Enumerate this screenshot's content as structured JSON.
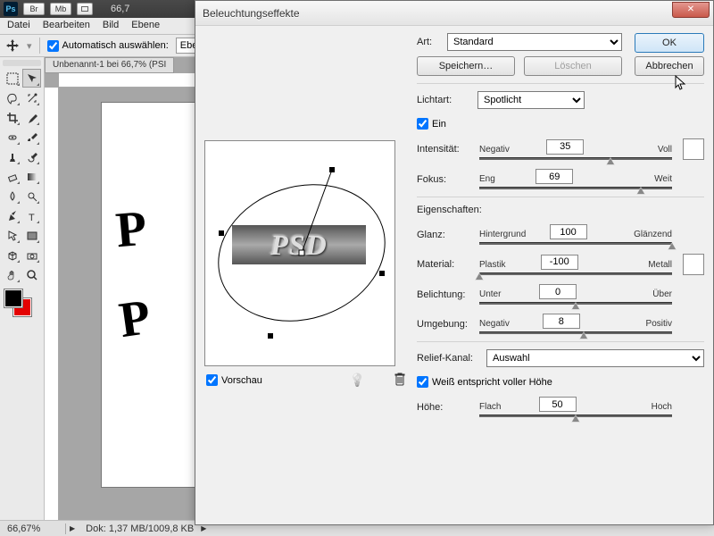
{
  "app": {
    "zoom_label": "66,7"
  },
  "titlebar_buttons": [
    "Br",
    "Mb"
  ],
  "menu": [
    "Datei",
    "Bearbeiten",
    "Bild",
    "Ebene"
  ],
  "options_bar": {
    "autoselect_label": "Automatisch auswählen:",
    "dropdown": "Ebe"
  },
  "document_tab": "Unbenannt-1 bei 66,7% (PSI",
  "canvas_text": "PSD",
  "statusbar": {
    "zoom": "66,67%",
    "docinfo": "Dok: 1,37 MB/1009,8 KB"
  },
  "dialog": {
    "title": "Beleuchtungseffekte",
    "buttons": {
      "ok": "OK",
      "cancel": "Abbrechen",
      "save": "Speichern…",
      "delete": "Löschen"
    },
    "art_label": "Art:",
    "art_value": "Standard",
    "preview_label": "Vorschau",
    "preview_text": "PSD",
    "lichtart_label": "Lichtart:",
    "lichtart_value": "Spotlicht",
    "ein_label": "Ein",
    "sliders": {
      "intensitaet": {
        "label": "Intensität:",
        "min": "Negativ",
        "max": "Voll",
        "value": 35,
        "pct": 68
      },
      "fokus": {
        "label": "Fokus:",
        "min": "Eng",
        "max": "Weit",
        "value": 69,
        "pct": 84
      },
      "glanz": {
        "label": "Glanz:",
        "min": "Hintergrund",
        "max": "Glänzend",
        "value": 100,
        "pct": 100
      },
      "material": {
        "label": "Material:",
        "min": "Plastik",
        "max": "Metall",
        "value": -100,
        "pct": 0
      },
      "belichtung": {
        "label": "Belichtung:",
        "min": "Unter",
        "max": "Über",
        "value": 0,
        "pct": 50
      },
      "umgebung": {
        "label": "Umgebung:",
        "min": "Negativ",
        "max": "Positiv",
        "value": 8,
        "pct": 54
      },
      "hoehe": {
        "label": "Höhe:",
        "min": "Flach",
        "max": "Hoch",
        "value": 50,
        "pct": 50
      }
    },
    "eigenschaften_label": "Eigenschaften:",
    "relief_label": "Relief-Kanal:",
    "relief_value": "Auswahl",
    "weiss_label": "Weiß entspricht voller Höhe",
    "light_color": "#ffffff",
    "ambient_color": "#ffffff"
  }
}
